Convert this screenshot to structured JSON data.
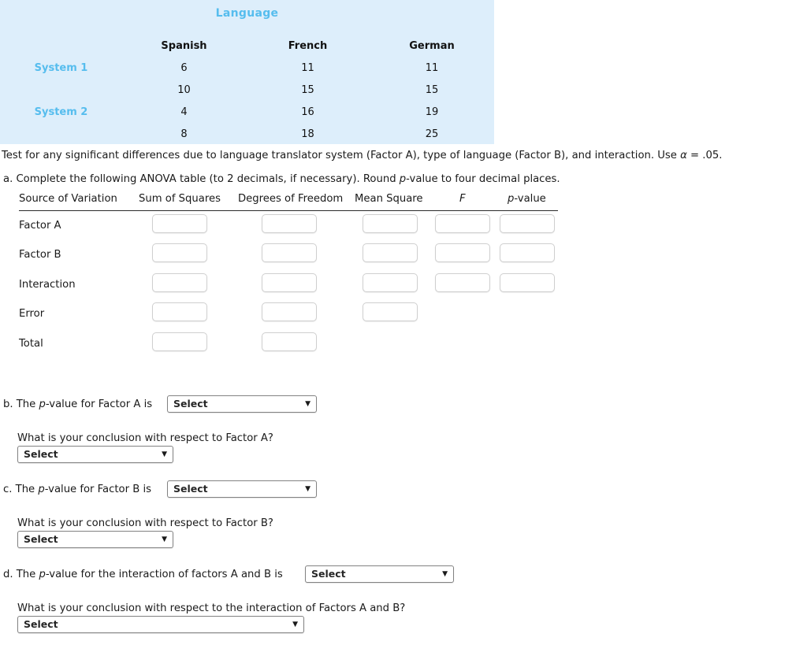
{
  "data_panel": {
    "title": "Language",
    "columns": [
      "Spanish",
      "French",
      "German"
    ],
    "rows": [
      {
        "label": "System 1",
        "values": [
          "6",
          "11",
          "11"
        ]
      },
      {
        "label": "",
        "values": [
          "10",
          "15",
          "15"
        ]
      },
      {
        "label": "System 2",
        "values": [
          "4",
          "16",
          "19"
        ]
      },
      {
        "label": "",
        "values": [
          "8",
          "18",
          "25"
        ]
      }
    ],
    "title_color": "#56bdee",
    "background_color": "#ddeefb"
  },
  "prompt": {
    "intro_before_alpha": "Test for any significant differences due to language translator system (Factor A), type of language (Factor B), and interaction. Use ",
    "alpha_symbol": "α",
    "intro_after_alpha": " = .05.",
    "part_a_pre": "a. Complete the following ANOVA table (to 2 decimals, if necessary). Round ",
    "part_a_italic": "p",
    "part_a_post": "-value to four decimal places."
  },
  "anova": {
    "headers": {
      "source": "Source of Variation",
      "sum_of_squares": "Sum of Squares",
      "degrees_of_freedom": "Degrees of Freedom",
      "mean_square": "Mean Square",
      "f": "F",
      "p_value_italic": "p",
      "p_value_rest": "-value"
    },
    "rows": [
      {
        "label": "Factor A",
        "ss": "",
        "df": "",
        "ms": "",
        "f": "",
        "p": ""
      },
      {
        "label": "Factor B",
        "ss": "",
        "df": "",
        "ms": "",
        "f": "",
        "p": ""
      },
      {
        "label": "Interaction",
        "ss": "",
        "df": "",
        "ms": "",
        "f": "",
        "p": ""
      },
      {
        "label": "Error",
        "ss": "",
        "df": "",
        "ms": ""
      },
      {
        "label": "Total",
        "ss": "",
        "df": ""
      }
    ],
    "input_placeholder": ""
  },
  "questions": {
    "b": {
      "prefix": "b. The ",
      "italic": "p",
      "suffix": "-value for Factor A is",
      "select_value": "Select",
      "conclusion_question": "What is your conclusion with respect to Factor A?",
      "conclusion_select_value": "Select"
    },
    "c": {
      "prefix": "c. The ",
      "italic": "p",
      "suffix": "-value for Factor B is",
      "select_value": "Select",
      "conclusion_question": "What is your conclusion with respect to Factor B?",
      "conclusion_select_value": "Select"
    },
    "d": {
      "prefix": "d. The ",
      "italic": "p",
      "suffix": "-value for the interaction of factors A and B is",
      "select_value": "Select",
      "conclusion_question": "What is your conclusion with respect to the interaction of Factors A and B?",
      "conclusion_select_value": "Select"
    }
  },
  "icons": {
    "dropdown_caret": "▼"
  }
}
